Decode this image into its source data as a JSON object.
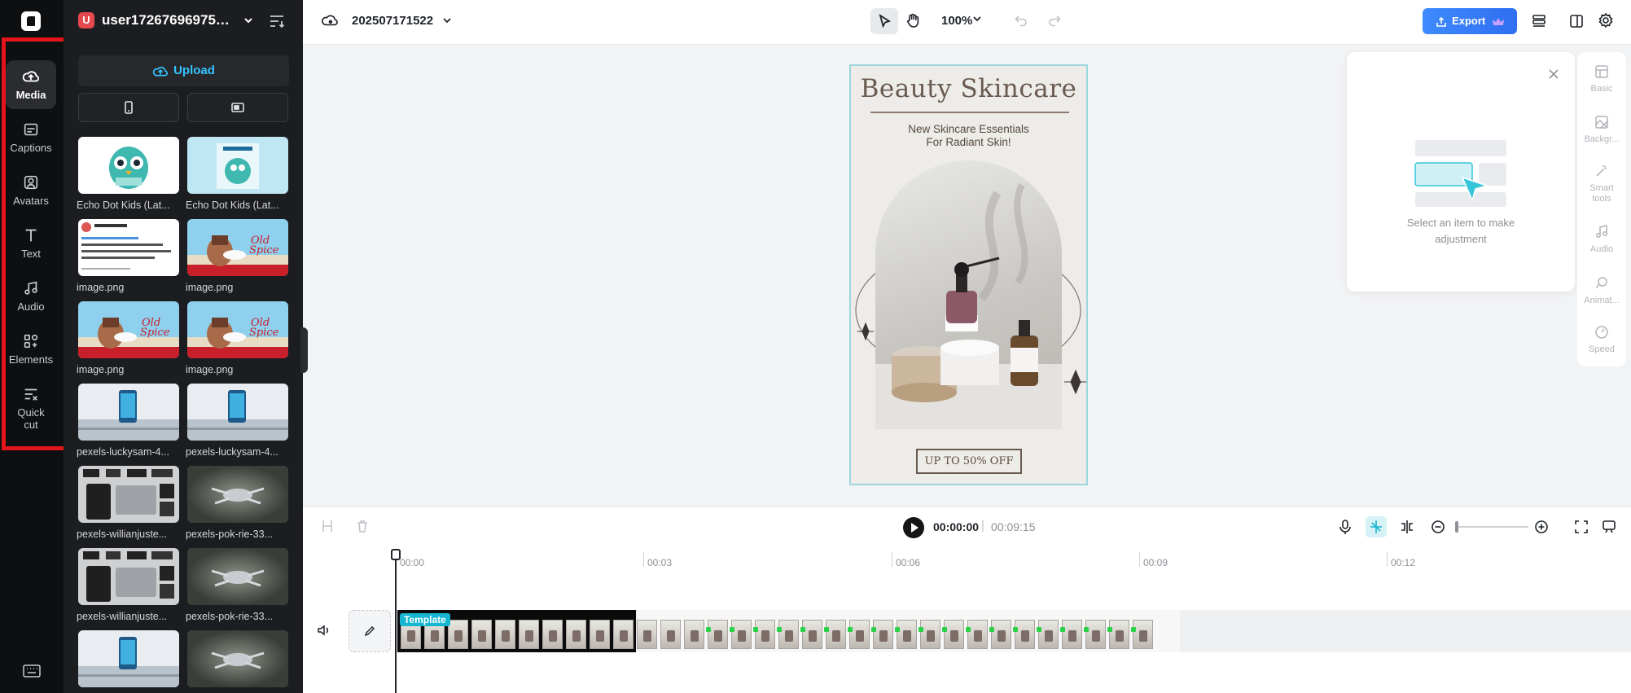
{
  "rail": {
    "items": [
      {
        "label": "Media",
        "icon": "cloud-upload-icon",
        "active": true
      },
      {
        "label": "Captions",
        "icon": "captions-icon"
      },
      {
        "label": "Avatars",
        "icon": "avatar-icon"
      },
      {
        "label": "Text",
        "icon": "text-icon"
      },
      {
        "label": "Audio",
        "icon": "music-note-icon"
      },
      {
        "label": "Elements",
        "icon": "elements-icon"
      },
      {
        "label": "Quick cut",
        "icon": "quick-cut-icon"
      }
    ],
    "highlight_color": "#e3141a"
  },
  "panel": {
    "user_initial": "U",
    "user_name": "user172676969755...",
    "upload_label": "Upload",
    "ratio_options": [
      "portrait",
      "landscape"
    ],
    "media": [
      {
        "caption": "Echo Dot Kids (Lat...",
        "thumb": "echo-owl"
      },
      {
        "caption": "Echo Dot Kids (Lat...",
        "thumb": "echo-box"
      },
      {
        "caption": "image.png",
        "thumb": "tweet"
      },
      {
        "caption": "image.png",
        "thumb": "oldspice"
      },
      {
        "caption": "image.png",
        "thumb": "oldspice"
      },
      {
        "caption": "image.png",
        "thumb": "oldspice"
      },
      {
        "caption": "pexels-luckysam-4...",
        "thumb": "phone"
      },
      {
        "caption": "pexels-luckysam-4...",
        "thumb": "phone"
      },
      {
        "caption": "pexels-willianjuste...",
        "thumb": "gadgets"
      },
      {
        "caption": "pexels-pok-rie-33...",
        "thumb": "drone"
      },
      {
        "caption": "pexels-willianjuste...",
        "thumb": "gadgets"
      },
      {
        "caption": "pexels-pok-rie-33...",
        "thumb": "drone"
      },
      {
        "caption": "",
        "thumb": "phone"
      },
      {
        "caption": "",
        "thumb": "drone"
      }
    ]
  },
  "topbar": {
    "project_name": "202507171522",
    "zoom": "100%",
    "export_label": "Export"
  },
  "canvas": {
    "title": "Beauty Skincare",
    "subtitle_line1": "New Skincare Essentials",
    "subtitle_line2": "For Radiant Skin!",
    "cta": "UP TO 50% OFF"
  },
  "properties": {
    "hint_line1": "Select an item to make",
    "hint_line2": "adjustment",
    "tabs": [
      {
        "label": "Basic",
        "icon": "basic-icon"
      },
      {
        "label": "Backgr...",
        "icon": "background-icon"
      },
      {
        "label": "Smart tools",
        "icon": "magic-wand-icon"
      },
      {
        "label": "Audio",
        "icon": "music-note-icon"
      },
      {
        "label": "Animat...",
        "icon": "animation-icon"
      },
      {
        "label": "Speed",
        "icon": "speed-icon"
      }
    ]
  },
  "timeline": {
    "current_time": "00:00:00",
    "separator": "|",
    "total_time": "00:09:15",
    "ruler": [
      "00:00",
      "00:03",
      "00:06",
      "00:09",
      "00:12"
    ],
    "clip_tag": "Template",
    "accent": "#16b6d1"
  }
}
